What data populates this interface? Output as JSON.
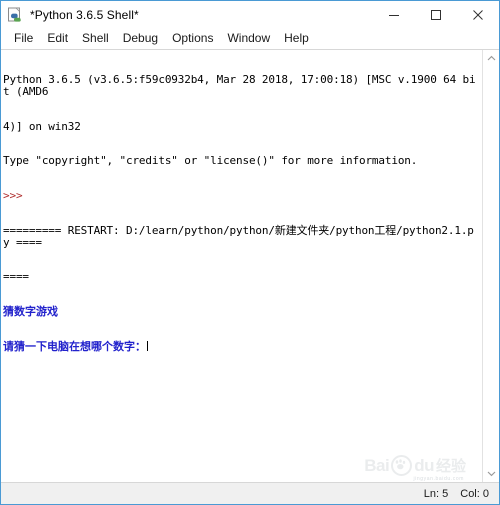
{
  "window": {
    "title": "*Python 3.6.5 Shell*",
    "icon": "idle-python-icon",
    "border_color": "#4a9ad4",
    "controls": {
      "minimize": "minimize-icon",
      "maximize": "maximize-icon",
      "close": "close-icon"
    }
  },
  "menubar": {
    "items": [
      {
        "label": "File"
      },
      {
        "label": "Edit"
      },
      {
        "label": "Shell"
      },
      {
        "label": "Debug"
      },
      {
        "label": "Options"
      },
      {
        "label": "Window"
      },
      {
        "label": "Help"
      }
    ]
  },
  "console": {
    "banner_line_1": "Python 3.6.5 (v3.6.5:f59c0932b4, Mar 28 2018, 17:00:18) [MSC v.1900 64 bit (AMD6",
    "banner_line_2": "4)] on win32",
    "banner_line_3": "Type \"copyright\", \"credits\" or \"license()\" for more information.",
    "prompt": ">>>",
    "restart_line_1": "========= RESTART: D:/learn/python/python/新建文件夹/python工程/python2.1.py ====",
    "restart_line_2": "====",
    "output_line_1": "猜数字游戏",
    "output_line_2": "请猜一下电脑在想哪个数字：",
    "colors": {
      "stdout_text": "#000000",
      "prompt_color": "#b03030",
      "program_output": "#2222cc"
    }
  },
  "scrollbar": {
    "up_arrow": "chevron-up-icon",
    "down_arrow": "chevron-down-icon"
  },
  "watermark": {
    "brand": "Bai",
    "paw": "paw-icon",
    "suffix": "du",
    "chinese": "经验",
    "subtitle": "jingyan.baidu.com"
  },
  "statusbar": {
    "line": "Ln: 5",
    "column": "Col: 0"
  }
}
